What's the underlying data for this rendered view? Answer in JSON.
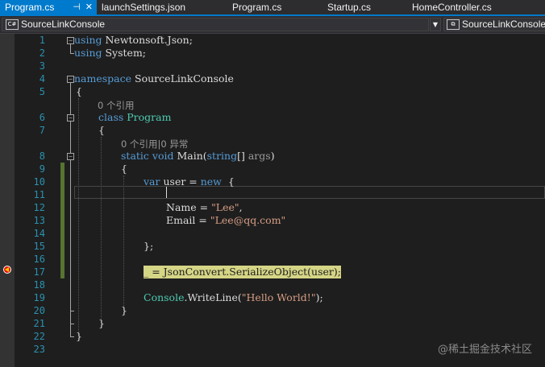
{
  "tabs": [
    {
      "label": "Program.cs",
      "active": true,
      "pin_icon": "pin-icon",
      "close_icon": "close-icon"
    },
    {
      "label": "launchSettings.json"
    },
    {
      "label": "Program.cs"
    },
    {
      "label": "Startup.cs"
    },
    {
      "label": "HomeController.cs"
    }
  ],
  "nav": {
    "project_icon_text": "C#",
    "project": "SourceLinkConsole",
    "dropdown_icon": "chevron-down-icon",
    "scope": "SourceLinkConsole"
  },
  "editor": {
    "line_numbers": [
      "1",
      "2",
      "3",
      "4",
      "5",
      "6",
      "7",
      "8",
      "9",
      "10",
      "11",
      "12",
      "13",
      "14",
      "15",
      "16",
      "17",
      "18",
      "19",
      "20",
      "21",
      "22",
      "23"
    ],
    "codelens": {
      "program_refs": "0 个引用",
      "main_refs": "0 个引用|0 异常"
    },
    "code": {
      "l1_kw": "using",
      "l1_rest": " Newtonsoft.Json;",
      "l2_kw": "using",
      "l2_rest": " System;",
      "l4_kw": "namespace",
      "l4_rest": " SourceLinkConsole",
      "l5": "{",
      "l6_kw": "class",
      "l6_type": " Program",
      "l7": "{",
      "l8_kw1": "static",
      "l8_kw2": " void",
      "l8_name": " Main(",
      "l8_kw3": "string",
      "l8_arr": "[] ",
      "l8_param": "args",
      "l8_end": ")",
      "l9": "{",
      "l10_kw": "var",
      "l10_mid": " user = ",
      "l10_kw2": "new",
      "l10_end": "  {",
      "l12_prop": "Name = ",
      "l12_str": "\"Lee\"",
      "l12_end": ",",
      "l13_prop": "Email = ",
      "l13_str": "\"Lee@qq.com\"",
      "l15": "};",
      "l17_expr": "_ = ",
      "l17_type": "JsonConvert",
      "l17_rest": ".SerializeObject(user);",
      "l19_type": "Console",
      "l19_call": ".WriteLine(",
      "l19_str": "\"Hello World!\"",
      "l19_end": ");",
      "l20": "}",
      "l21": "}",
      "l22": "}"
    },
    "breakpoint_icon": "breakpoint-icon",
    "breakpoint_color": "#e51400",
    "highlight_color": "#d5d586"
  },
  "watermark": "@稀土掘金技术社区",
  "colors": {
    "keyword": "#569cd6",
    "type": "#4ec9b0",
    "string": "#d69d85",
    "line_number": "#2b91af",
    "accent": "#007acc"
  }
}
